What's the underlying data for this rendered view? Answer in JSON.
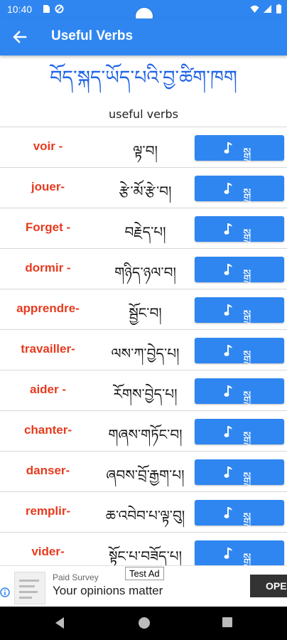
{
  "status": {
    "time": "10:40"
  },
  "appbar": {
    "title": "Useful Verbs",
    "back_icon": "arrow-left-icon"
  },
  "heading": {
    "tibetan": "བོད་སྐད་ཡོད་པའི་བྱ་ཚིག་ཁག",
    "subtitle": "useful verbs"
  },
  "colors": {
    "primary": "#2f86f0",
    "french_text": "#e63b1f",
    "heading": "#1e63e6"
  },
  "verbs": [
    {
      "fr": "voir -",
      "bo": "ལྟ་བ།",
      "audio_label": "སྒྲ"
    },
    {
      "fr": "jouer-",
      "bo": "རྩེ་མོ་རྩེ་བ།",
      "audio_label": "སྒྲ"
    },
    {
      "fr": "Forget -",
      "bo": "བརྗེད་པ།",
      "audio_label": "སྒྲ"
    },
    {
      "fr": "dormir -",
      "bo": "གཉིད་ཉལ་བ།",
      "audio_label": "སྒྲ"
    },
    {
      "fr": "apprendre-",
      "bo": "སྦྱོང་བ།",
      "audio_label": "སྒྲ"
    },
    {
      "fr": "travailler-",
      "bo": "ལས་ཀ་བྱེད་པ།",
      "audio_label": "སྒྲ"
    },
    {
      "fr": "aider -",
      "bo": "རོགས་བྱེད་པ།",
      "audio_label": "སྒྲ"
    },
    {
      "fr": "chanter-",
      "bo": "གཞས་གཏོང་བ།",
      "audio_label": "སྒྲ"
    },
    {
      "fr": "danser-",
      "bo": "ཞབས་བྲོ་རྒྱག་པ།",
      "audio_label": "སྒྲ"
    },
    {
      "fr": "remplir-",
      "bo": "ཆ་འབེབ་པ་ལྟ་བུ།",
      "audio_label": "སྒྲ"
    },
    {
      "fr": "vider-",
      "bo": "སྟོང་པ་བཟོད་པ།",
      "audio_label": "སྒྲ"
    }
  ],
  "ad": {
    "sponsor": "Paid Survey",
    "tag": "Test Ad",
    "headline": "Your opinions matter",
    "cta": "OPEN"
  }
}
